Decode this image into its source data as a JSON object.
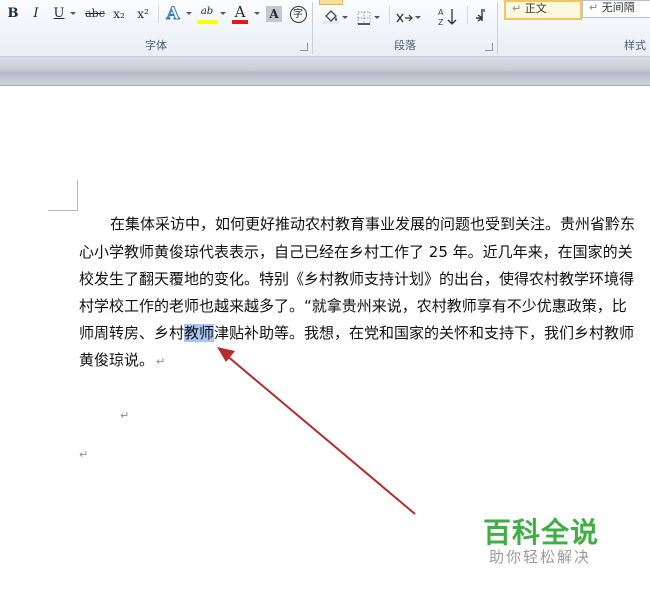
{
  "ribbon": {
    "font_group_label": "字体",
    "paragraph_group_label": "段落",
    "styles_group_label": "样式",
    "buttons": {
      "bold": "B",
      "italic": "I",
      "underline": "U",
      "strikethrough": "abc",
      "subscript": "x₂",
      "superscript": "x²",
      "text_effects": "A",
      "highlight": "ab",
      "font_color": "A",
      "char_shading": "A",
      "enclose_char": "字"
    },
    "styles": {
      "normal": "正文",
      "no_spacing": "无间隔"
    }
  },
  "document": {
    "lines": [
      "在集体采访中，如何更好推动农村教育事业发展的问题也受到关注。贵州省黔东",
      "心小学教师黄俊琼代表表示，自己已经在乡村工作了 25 年。近几年来，在国家的关",
      "校发生了翻天覆地的变化。特别《乡村教师支持计划》的出台，使得农村教学环境得",
      "村学校工作的老师也越来越多了。“就拿贵州来说，农村教师享有不少优惠政策，比",
      {
        "before": "师周转房、乡村",
        "selected": "教师",
        "after": "津贴补助等。我想，在党和国家的关怀和支持下，我们乡村教师"
      },
      "黄俊琼说。"
    ],
    "paragraph_mark": "↵"
  },
  "watermark": {
    "title": "百科全说",
    "subtitle": "助你轻松解决"
  }
}
